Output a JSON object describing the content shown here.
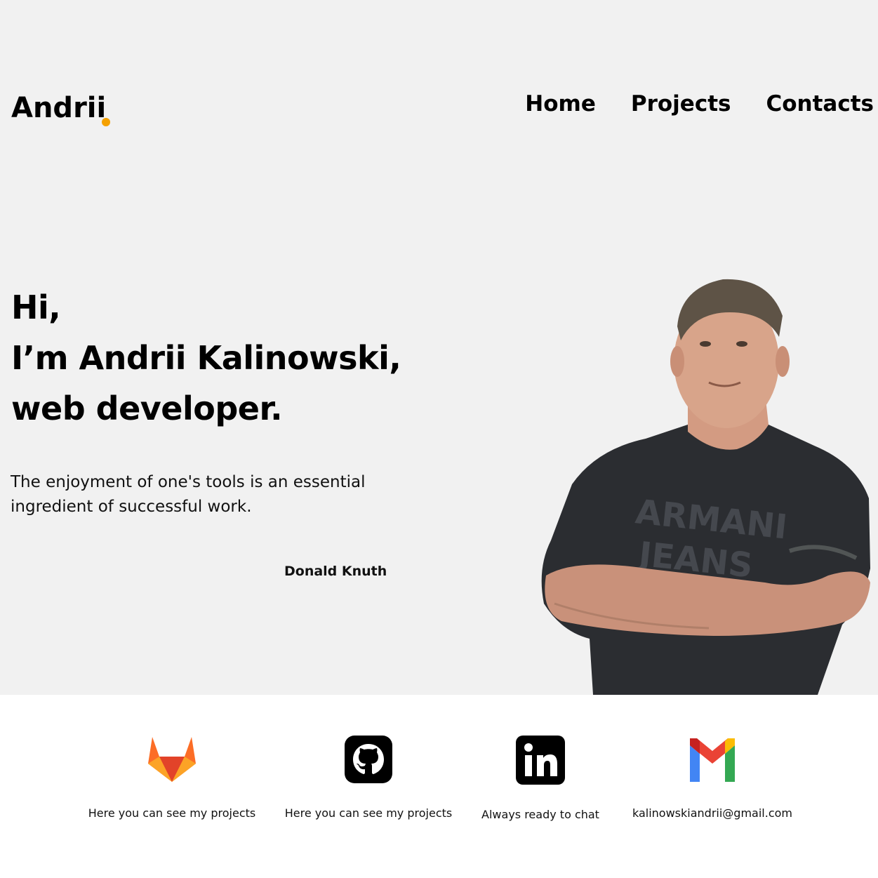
{
  "header": {
    "logo_text": "Andrii",
    "accent_color": "#f5a100",
    "nav": [
      {
        "label": "Home"
      },
      {
        "label": "Projects"
      },
      {
        "label": "Contacts"
      }
    ]
  },
  "hero": {
    "line1": "Hi,",
    "line2": "I’m Andrii Kalinowski,",
    "line3": "web developer.",
    "quote": "The enjoyment of one's tools is an essential ingredient of successful work.",
    "author": "Donald Knuth"
  },
  "socials": [
    {
      "icon": "gitlab-icon",
      "caption": "Here you can see my projects"
    },
    {
      "icon": "github-icon",
      "caption": "Here you can see my projects"
    },
    {
      "icon": "linkedin-icon",
      "caption": "Always ready to chat"
    },
    {
      "icon": "gmail-icon",
      "caption": "kalinowskiandrii@gmail.com"
    }
  ]
}
